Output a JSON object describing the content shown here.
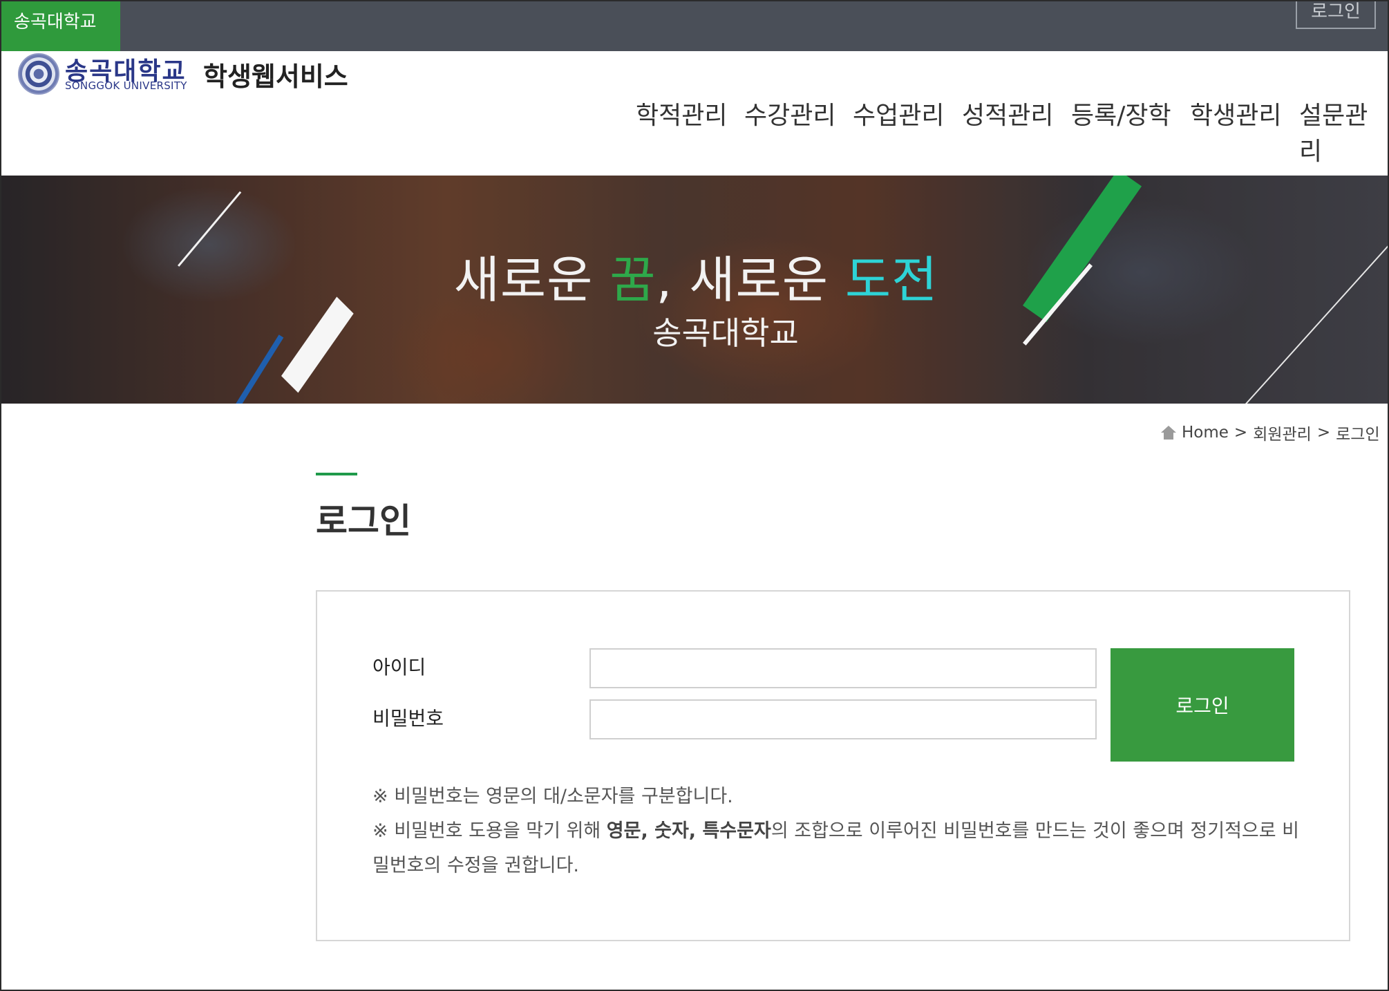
{
  "top_bar": {
    "university_tab": "송곡대학교",
    "login_link": "로그인"
  },
  "header": {
    "logo_korean": "송곡대학교",
    "logo_english": "SONGGOK UNIVERSITY",
    "site_title": "학생웹서비스",
    "nav": [
      "학적관리",
      "수강관리",
      "수업관리",
      "성적관리",
      "등록/장학",
      "학생관리",
      "설문관리"
    ]
  },
  "banner": {
    "headline_part1": "새로운 ",
    "headline_green": "꿈",
    "headline_part2": ", 새로운 ",
    "headline_cyan": "도전",
    "subtitle": "송곡대학교",
    "colors": {
      "green": "#2ea84a",
      "cyan": "#2ed3d6"
    }
  },
  "breadcrumb": {
    "home": "Home",
    "sep1": ">",
    "section": "회원관리",
    "sep2": ">",
    "current": "로그인"
  },
  "page": {
    "title": "로그인"
  },
  "login_form": {
    "id_label": "아이디",
    "id_value": "",
    "password_label": "비밀번호",
    "password_value": "",
    "submit_label": "로그인",
    "button_color": "#389a3f"
  },
  "notices": {
    "line1": "※ 비밀번호는 영문의 대/소문자를 구분합니다.",
    "line2_prefix": "※ 비밀번호 도용을 막기 위해 ",
    "line2_bold": "영문, 숫자, 특수문자",
    "line2_suffix": "의 조합으로 이루어진 비밀번호를 만드는 것이 좋으며 정기적으로 비",
    "line3": "밀번호의 수정을 권합니다."
  }
}
